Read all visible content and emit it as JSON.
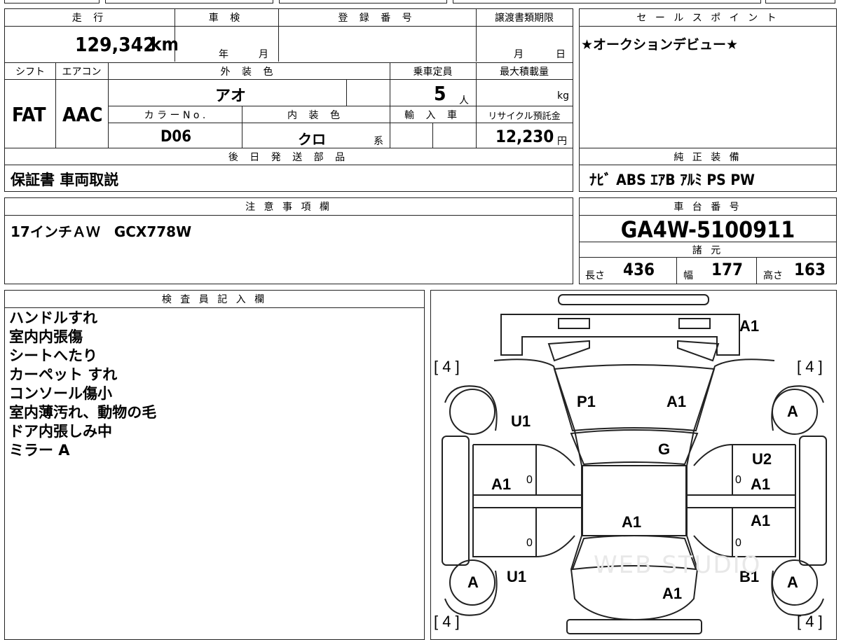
{
  "top_row": {
    "mileage_label": "走 行",
    "mileage_value": "129,342",
    "mileage_unit": "km",
    "inspection_label": "車 検",
    "inspection_year_unit": "年",
    "inspection_month_unit": "月",
    "registration_label": "登 録 番 号",
    "transfer_label": "譲渡書類期限",
    "transfer_month_unit": "月",
    "transfer_day_unit": "日"
  },
  "second_row": {
    "shift_label": "シフト",
    "shift_value": "FAT",
    "aircon_label": "エアコン",
    "aircon_value": "AAC",
    "exterior_color_label": "外 装 色",
    "exterior_color_value": "アオ",
    "capacity_label": "乗車定員",
    "capacity_value": "5",
    "capacity_unit": "人",
    "max_load_label": "最大積載量",
    "max_load_unit": "kg",
    "color_no_label": "カ ラ ー N o .",
    "color_no_value": "D06",
    "interior_color_label": "内 装 色",
    "interior_color_value": "クロ",
    "interior_color_suffix": "系",
    "import_label": "輸 入 車",
    "recycle_label": "リサイクル預託金",
    "recycle_value": "12,230",
    "recycle_unit": "円"
  },
  "later_parts": {
    "label": "後 日 発 送 部 品",
    "value": "保証書 車両取説"
  },
  "sales_points": {
    "label": "セ ー ル ス ポ イ ン ト",
    "value": "★オークションデビュー★"
  },
  "genuine_equipment": {
    "label": "純 正 装 備",
    "value": "ﾅﾋﾞ ABS ｴｱB ｱﾙﾐ PS PW"
  },
  "notes": {
    "label": "注 意 事 項 欄",
    "value": "17インチＡＷ　GCX778W"
  },
  "chassis": {
    "label": "車 台 番 号",
    "value": "GA4W-5100911"
  },
  "specs": {
    "label": "諸 元",
    "length_label": "長さ",
    "length_value": "436",
    "width_label": "幅",
    "width_value": "177",
    "height_label": "高さ",
    "height_value": "163"
  },
  "inspector": {
    "label": "検 査 員 記 入 欄",
    "lines": [
      "ハンドルすれ",
      "室内内張傷",
      "シートへたり",
      "カーペット すれ",
      "コンソール傷小",
      "室内薄汚れ、動物の毛",
      "ドア内張しみ中",
      "ミラー A"
    ]
  },
  "diagram": {
    "tire_tl": "[ 4 ]",
    "tire_tr": "[ 4 ]",
    "tire_bl": "[ 4 ]",
    "tire_br": "[ 4 ]",
    "marks": {
      "front_bumper": "A1",
      "hood_left": "P1",
      "hood_right": "A1",
      "front_left_fender": "U1",
      "wheel_front_right": "A",
      "windshield": "G",
      "front_right_fender": "U2",
      "front_left_door": "A1",
      "front_right_door": "A1",
      "roof": "A1",
      "rear_right_door": "A1",
      "rear_left_wheel": "A",
      "rear_left_fender": "U1",
      "rear_right_fender": "B1",
      "rear_right_wheel": "A",
      "rear_panel": "A1",
      "zero_1": "0",
      "zero_2": "0",
      "zero_3": "0",
      "zero_4": "0"
    },
    "watermark": "WEB STUDIO"
  }
}
